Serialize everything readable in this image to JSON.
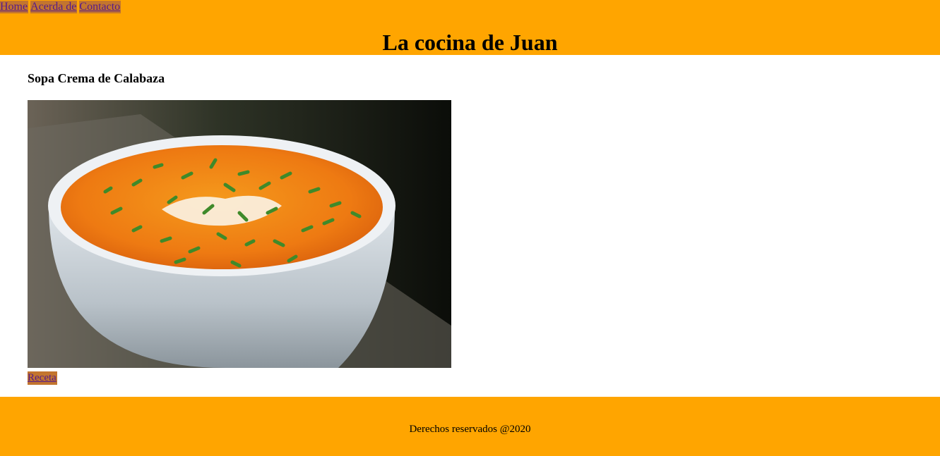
{
  "header": {
    "nav": [
      "Home",
      "Acerda de",
      "Contacto"
    ],
    "site_title": "La cocina de Juan"
  },
  "main": {
    "recipe_title": "Sopa Crema de Calabaza",
    "image_icon": "pumpkin-soup-photo",
    "recipe_link": "Receta"
  },
  "footer": {
    "copyright": "Derechos reservados @2020"
  },
  "colors": {
    "header_bg": "#ffa500",
    "footer_bg": "#ffa500",
    "link_bg": "#c3752e",
    "link_text": "#551a8b"
  }
}
